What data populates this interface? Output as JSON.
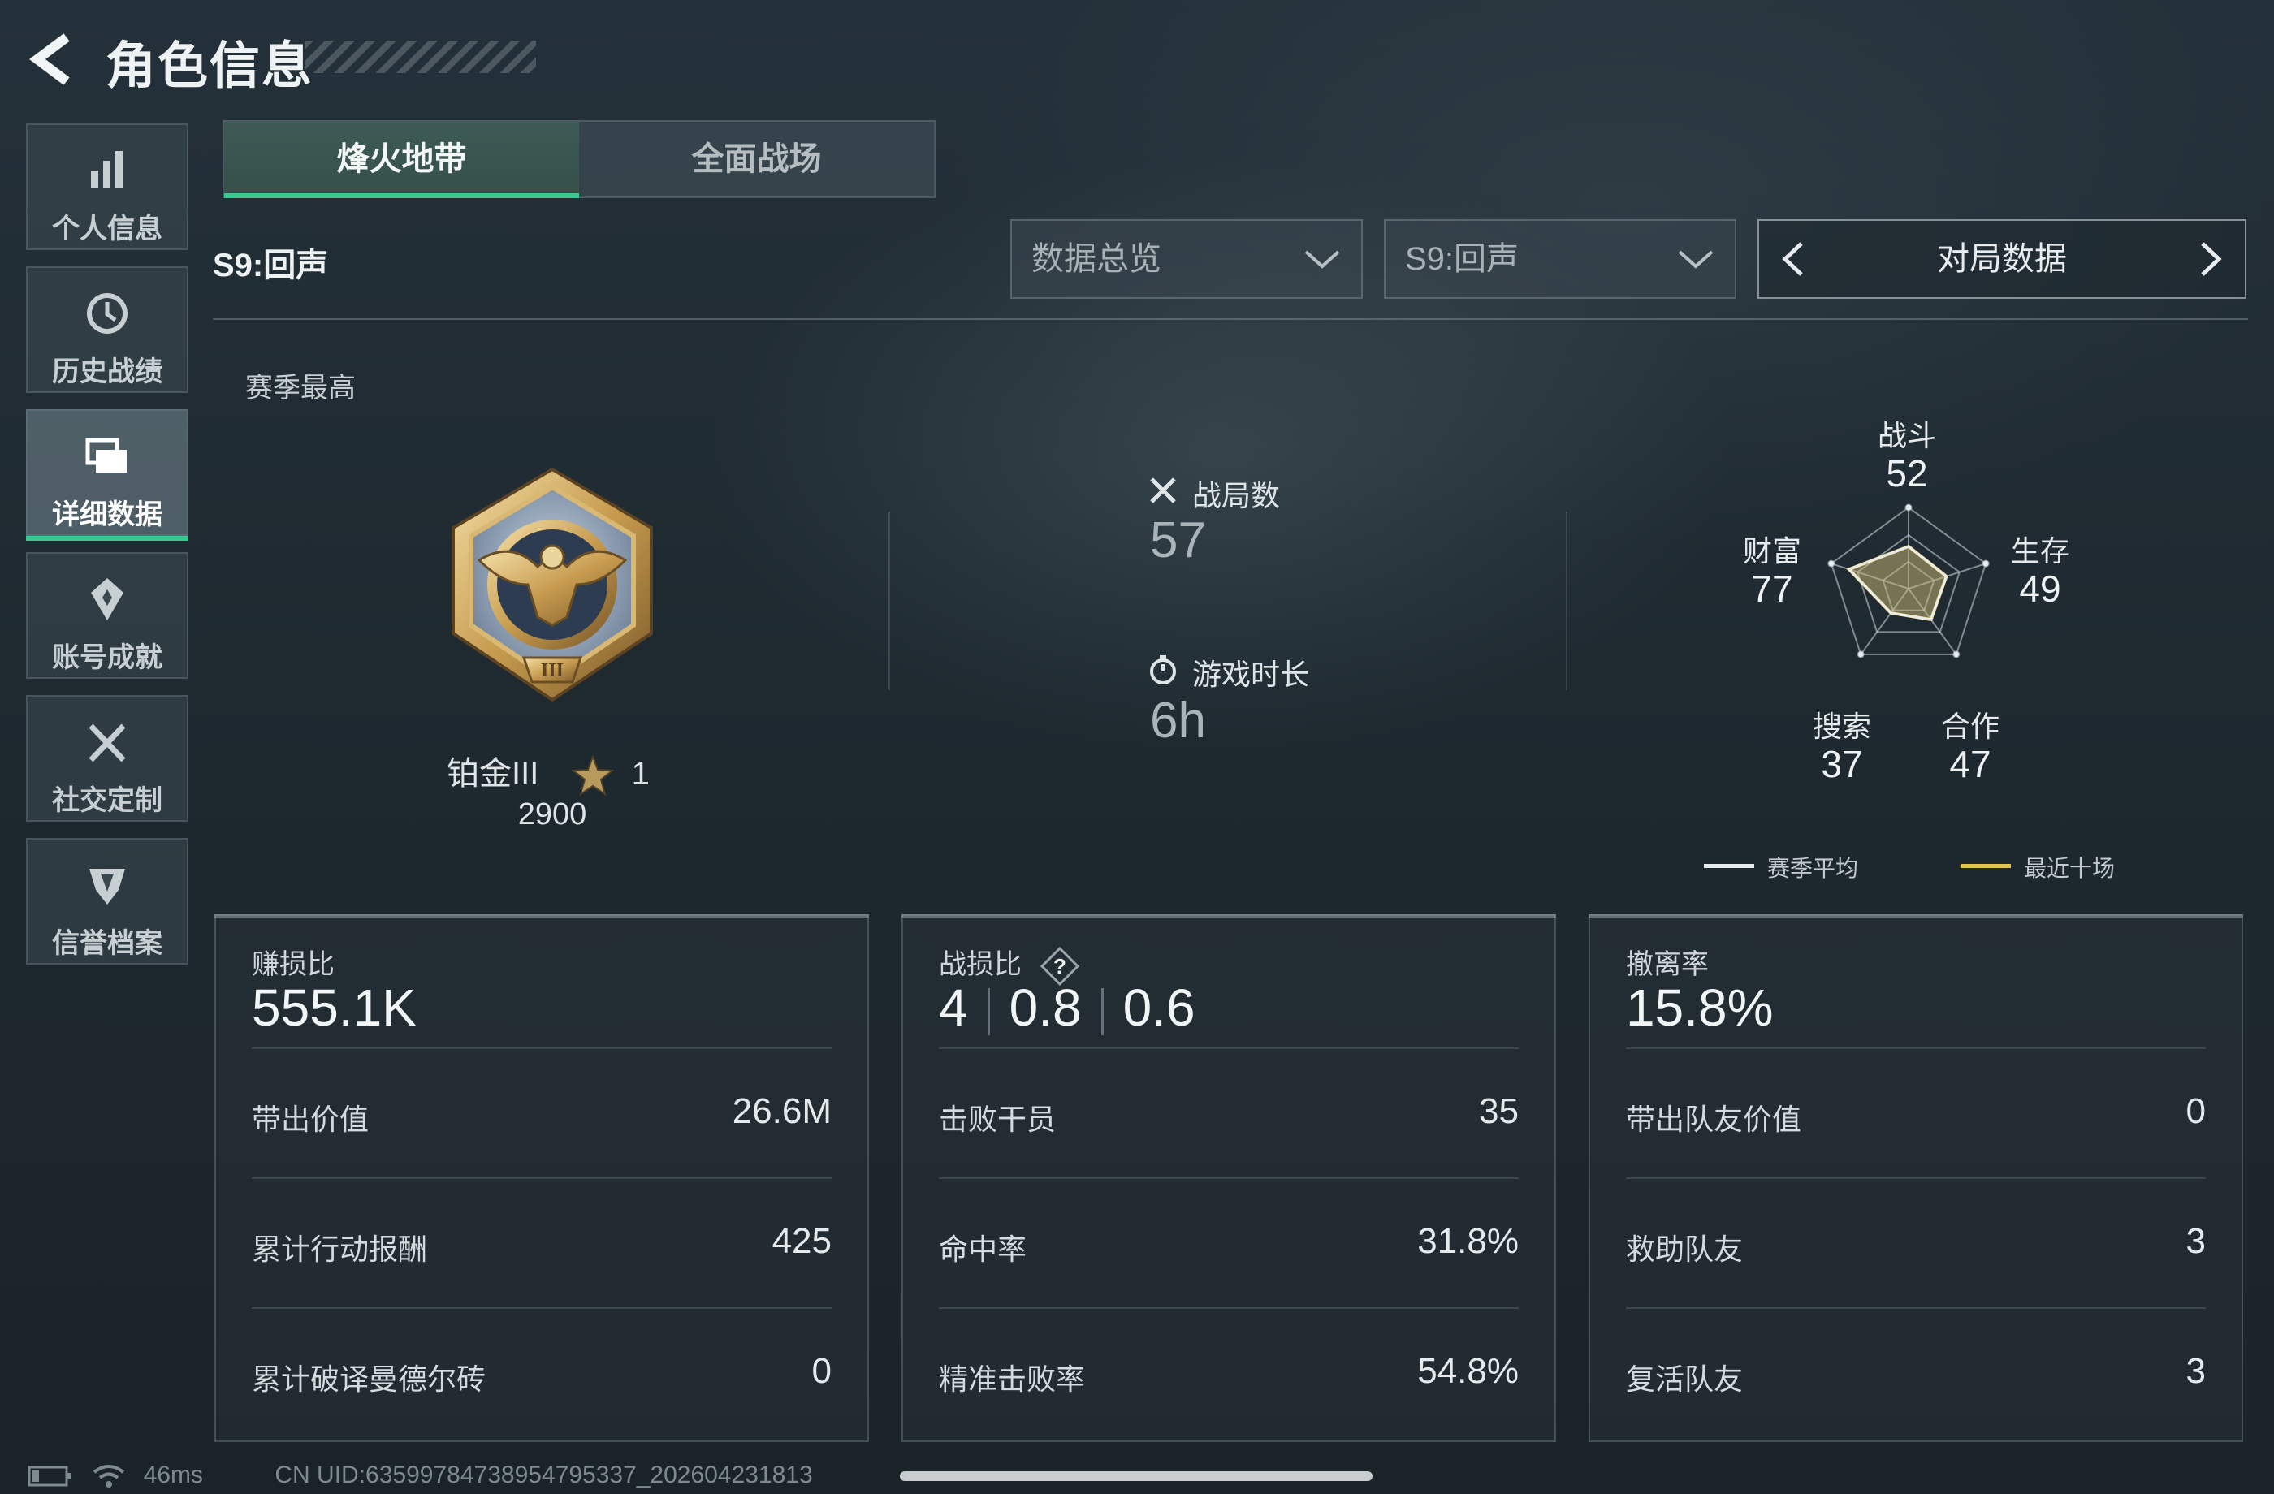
{
  "header": {
    "title": "角色信息"
  },
  "sidebar": {
    "items": [
      {
        "label": "个人信息",
        "icon": "bar-chart-icon",
        "active": false
      },
      {
        "label": "历史战绩",
        "icon": "clock-history-icon",
        "active": false
      },
      {
        "label": "详细数据",
        "icon": "folder-data-icon",
        "active": true
      },
      {
        "label": "账号成就",
        "icon": "achievement-badge-icon",
        "active": false
      },
      {
        "label": "社交定制",
        "icon": "crossed-tools-icon",
        "active": false
      },
      {
        "label": "信誉档案",
        "icon": "shield-emblem-icon",
        "active": false
      }
    ]
  },
  "tabs": [
    {
      "label": "烽火地带",
      "active": true
    },
    {
      "label": "全面战场",
      "active": false
    }
  ],
  "season_label": "S9:回声",
  "filters": {
    "overview": {
      "value": "数据总览"
    },
    "season": {
      "value": "S9:回声"
    },
    "match_nav": {
      "label": "对局数据"
    }
  },
  "season_best": {
    "title": "赛季最高",
    "rank": "铂金III",
    "stars": "1",
    "score": "2900"
  },
  "stats": {
    "matches": {
      "label": "战局数",
      "value": "57"
    },
    "playtime": {
      "label": "游戏时长",
      "value": "6h"
    }
  },
  "radar": {
    "axes": [
      {
        "label": "战斗",
        "value": "52"
      },
      {
        "label": "生存",
        "value": "49"
      },
      {
        "label": "合作",
        "value": "47"
      },
      {
        "label": "搜索",
        "value": "37"
      },
      {
        "label": "财富",
        "value": "77"
      }
    ],
    "legend": [
      {
        "label": "赛季平均",
        "color": "#e8ecee"
      },
      {
        "label": "最近十场",
        "color": "#e3c350"
      }
    ]
  },
  "cards": {
    "profit": {
      "title": "赚损比",
      "main": "555.1K",
      "rows": [
        {
          "label": "带出价值",
          "value": "26.6M"
        },
        {
          "label": "累计行动报酬",
          "value": "425"
        },
        {
          "label": "累计破译曼德尔砖",
          "value": "0"
        }
      ]
    },
    "kd": {
      "title": "战损比",
      "main": [
        "4",
        "0.8",
        "0.6"
      ],
      "rows": [
        {
          "label": "击败干员",
          "value": "35"
        },
        {
          "label": "命中率",
          "value": "31.8%"
        },
        {
          "label": "精准击败率",
          "value": "54.8%"
        }
      ]
    },
    "extract": {
      "title": "撤离率",
      "main": "15.8%",
      "rows": [
        {
          "label": "带出队友价值",
          "value": "0"
        },
        {
          "label": "救助队友",
          "value": "3"
        },
        {
          "label": "复活队友",
          "value": "3"
        }
      ]
    }
  },
  "status": {
    "ping": "46ms",
    "uid": "CN UID:6359978473895479533​7_202604231813"
  },
  "colors": {
    "accent": "#39c98f",
    "recent_line": "#e3c350"
  }
}
